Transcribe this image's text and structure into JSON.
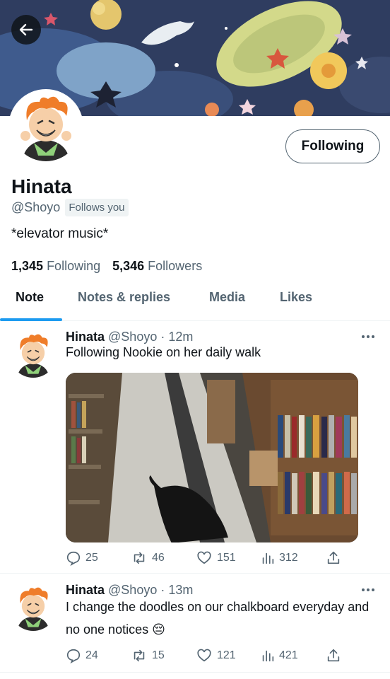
{
  "profile": {
    "name": "Hinata",
    "handle": "@Shoyo",
    "follows_you": "Follows you",
    "bio": "*elevator music*",
    "following_count": "1,345",
    "following_label": "Following",
    "followers_count": "5,346",
    "followers_label": "Followers",
    "follow_button": "Following"
  },
  "tabs": [
    {
      "label": "Note",
      "active": true
    },
    {
      "label": "Notes & replies",
      "active": false
    },
    {
      "label": "Media",
      "active": false
    },
    {
      "label": "Likes",
      "active": false
    }
  ],
  "posts": [
    {
      "name": "Hinata",
      "handle": "@Shoyo",
      "time": "12m",
      "text": "Following Nookie on her daily walk",
      "replies": "25",
      "reposts": "46",
      "likes": "151",
      "views": "312"
    },
    {
      "name": "Hinata",
      "handle": "@Shoyo",
      "time": "13m",
      "text": "I change the doodles on our chalkboard everyday and no one notices 😔",
      "replies": "24",
      "reposts": "15",
      "likes": "121",
      "views": "421"
    }
  ],
  "colors": {
    "accent": "#1d9bf0",
    "text_primary": "#0f1419",
    "text_secondary": "#536471",
    "divider": "#eff3f4"
  },
  "icons": {
    "back": "arrow-left-icon",
    "more": "more-horizontal-icon",
    "reply": "comment-bubble-icon",
    "repost": "repost-arrows-icon",
    "like": "heart-icon",
    "views": "bar-chart-icon",
    "share": "share-upload-icon"
  }
}
